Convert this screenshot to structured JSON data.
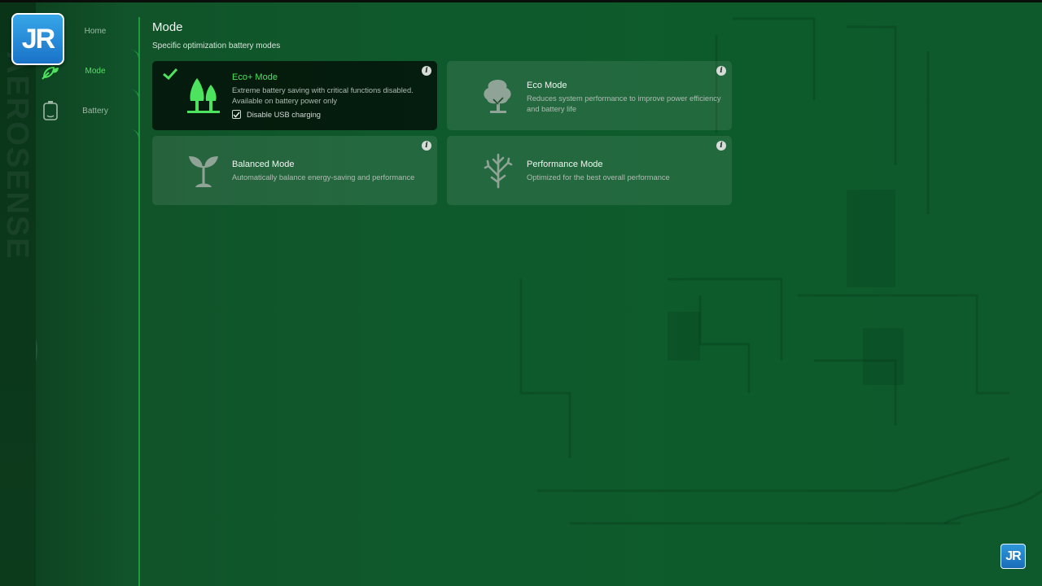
{
  "nav": {
    "items": [
      {
        "label": "Home",
        "active": false
      },
      {
        "label": "Mode",
        "active": true
      },
      {
        "label": "Battery",
        "active": false
      }
    ]
  },
  "branding": {
    "sidebar_watermark": "AEROSENSE",
    "logo_text": "JR"
  },
  "page": {
    "title": "Mode",
    "subtitle": "Specific optimization battery modes"
  },
  "modes": [
    {
      "name": "Eco+ Mode",
      "description": "Extreme battery saving with critical functions disabled. Available on battery power only",
      "selected": true,
      "icon": "trees-icon",
      "option": {
        "label": "Disable USB charging",
        "checked": true
      }
    },
    {
      "name": "Eco Mode",
      "description": "Reduces system performance to improve power efficiency and battery life",
      "selected": false,
      "icon": "tree-icon"
    },
    {
      "name": "Balanced Mode",
      "description": "Automatically balance energy-saving and performance",
      "selected": false,
      "icon": "sprout-icon"
    },
    {
      "name": "Performance Mode",
      "description": "Optimized for the best overall performance",
      "selected": false,
      "icon": "bare-tree-icon"
    }
  ],
  "info_glyph": "i",
  "colors": {
    "accent": "#4ee35e",
    "background": "#0f5a2c",
    "selected_card": "#0b160f"
  }
}
